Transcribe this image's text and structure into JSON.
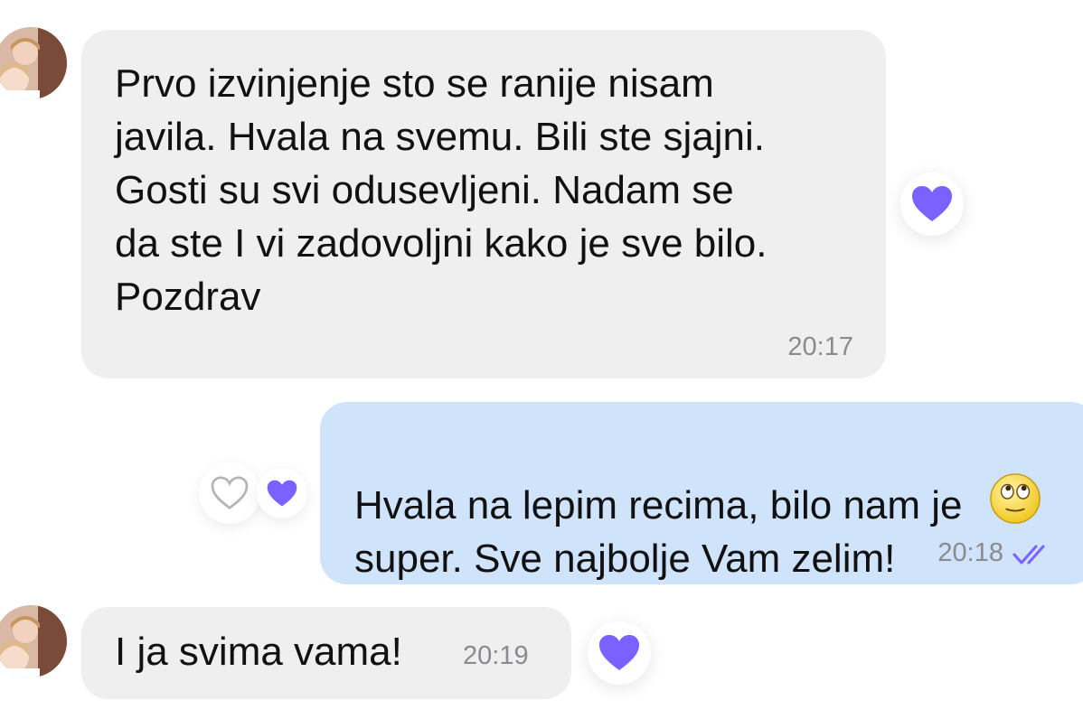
{
  "messages": [
    {
      "text": "Prvo izvinjenje sto se ranije nisam\njavila. Hvala na svemu. Bili ste sjajni.\nGosti su svi odusevljeni. Nadam se\nda ste I vi zadovoljni kako je sve bilo.\nPozdrav",
      "time": "20:17",
      "direction": "incoming",
      "reaction": "purple-heart-icon"
    },
    {
      "text": "Hvala na lepim recima, bilo nam je\nsuper. Sve najbolje Vam zelim!",
      "emoji": "rolling-eyes-emoji",
      "time": "20:18",
      "direction": "outgoing",
      "status": "read-double-check-icon",
      "reactions": [
        "outline-heart-icon",
        "purple-heart-icon"
      ]
    },
    {
      "text": "I ja svima vama!",
      "time": "20:19",
      "direction": "incoming",
      "reaction": "purple-heart-icon"
    }
  ],
  "colors": {
    "incoming_bubble": "#efefef",
    "outgoing_bubble": "#cfe3fb",
    "accent_purple": "#7b61ff",
    "timestamp": "#8a8a8f"
  }
}
